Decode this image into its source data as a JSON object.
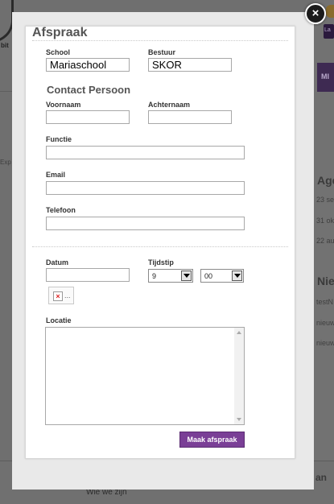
{
  "background": {
    "logo_text": "bit",
    "side_text_exp": "Exp",
    "tab_short": "MI",
    "badge_text": "La",
    "agenda_heading": "Age",
    "agenda_items": [
      "23 se",
      "31 ok",
      "22 au"
    ],
    "news_heading": "Nie",
    "news_items": [
      "testN",
      "nieuw",
      "nieuw"
    ],
    "footer_link": "Wie we zijn",
    "footer_side": "an"
  },
  "modal": {
    "title": "Afspraak",
    "school_label": "School",
    "school_value": "Mariaschool",
    "bestuur_label": "Bestuur",
    "bestuur_value": "SKOR",
    "contact_heading": "Contact Persoon",
    "voornaam_label": "Voornaam",
    "voornaam_value": "",
    "achternaam_label": "Achternaam",
    "achternaam_value": "",
    "functie_label": "Functie",
    "functie_value": "",
    "email_label": "Email",
    "email_value": "",
    "telefoon_label": "Telefoon",
    "telefoon_value": "",
    "datum_label": "Datum",
    "datum_value": "",
    "tijdstip_label": "Tijdstip",
    "hour_value": "9",
    "minute_value": "00",
    "broken_image_text": "...",
    "locatie_label": "Locatie",
    "submit_label": "Maak afspraak",
    "close_icon": "close-icon"
  },
  "colors": {
    "accent": "#7a3f96",
    "overlay": "#6f6f6f",
    "modal_bg": "#ffffff"
  }
}
